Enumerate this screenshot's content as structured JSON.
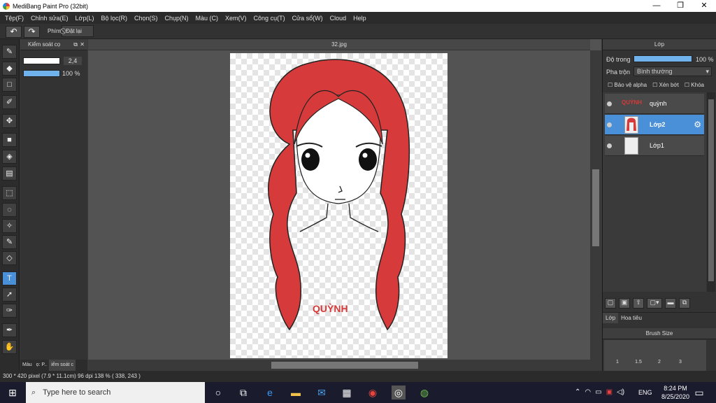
{
  "window": {
    "title": "MediBang Paint Pro (32bit)",
    "minimize": "—",
    "maximize": "❐",
    "close": "✕"
  },
  "menu": [
    "Tệp(F)",
    "Chỉnh sửa(E)",
    "Lớp(L)",
    "Bộ lọc(R)",
    "Chọn(S)",
    "Chụp(N)",
    "Màu (C)",
    "Xem(V)",
    "Công cụ(T)",
    "Cửa sổ(W)",
    "Cloud",
    "Help"
  ],
  "toolbar": {
    "undo_icon": "↶",
    "redo_icon": "↷",
    "shortcut_label": "Phím",
    "reset_label": "Đặt lại"
  },
  "brush_panel": {
    "title": "Kiểm soát cọ",
    "size_value": "2,4",
    "opacity_value": "100 %",
    "tabs": [
      "Màu",
      "ọ: P..",
      "iểm soát c"
    ]
  },
  "canvas": {
    "tab_title": "32.jpg",
    "artwork_text": "QUỲNH"
  },
  "layer_panel": {
    "title": "Lớp",
    "opacity_label": "Độ trong",
    "opacity_value": "100 %",
    "opacity_fraction": 1.0,
    "blend_label": "Pha trộn",
    "blend_value": "Bình thường",
    "protect_alpha": "Bảo vệ alpha",
    "clipping": "Xén bớt",
    "lock": "Khóa",
    "layers": [
      {
        "name": "quỳnh",
        "thumb_text": "QUỲNH"
      },
      {
        "name": "Lớp2"
      },
      {
        "name": "Lớp1"
      }
    ],
    "bottom_tabs": [
      "Lớp",
      "Hoa tiêu"
    ]
  },
  "brush_size_panel": {
    "title": "Brush Size",
    "sizes": [
      "1",
      "1.5",
      "2",
      "3"
    ]
  },
  "status": {
    "text": "300 * 420 pixel   (7.9 * 11.1cm)   96 dpi   138 %   ( 338, 243 )"
  },
  "taskbar": {
    "search_placeholder": "Type here to search",
    "lang": "ENG",
    "time": "8:24 PM",
    "date": "8/25/2020"
  },
  "colors": {
    "accent": "#4a90d9",
    "hair": "#d63a3a"
  }
}
